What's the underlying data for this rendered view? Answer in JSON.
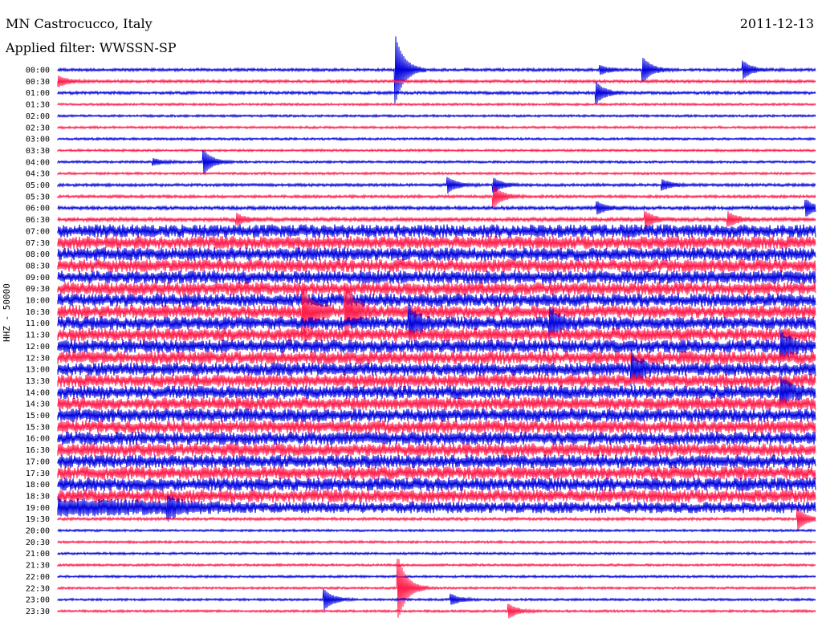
{
  "header": {
    "station": "MN Castrocucco, Italy",
    "date": "2011-12-13",
    "filter": "Applied filter: WWSSN-SP"
  },
  "chart_data": {
    "type": "line",
    "title": "MN Castrocucco, Italy",
    "subtitle": "Applied filter: WWSSN-SP",
    "ylabel": "HHZ - 50000",
    "xlabel": "",
    "colors": [
      "#0000dd",
      "#ff1a4a"
    ],
    "grid": false,
    "categories": [
      "00:00",
      "00:30",
      "01:00",
      "01:30",
      "02:00",
      "02:30",
      "03:00",
      "03:30",
      "04:00",
      "04:30",
      "05:00",
      "05:30",
      "06:00",
      "06:30",
      "07:00",
      "07:30",
      "08:00",
      "08:30",
      "09:00",
      "09:30",
      "10:00",
      "10:30",
      "11:00",
      "11:30",
      "12:00",
      "12:30",
      "13:00",
      "13:30",
      "14:00",
      "14:30",
      "15:00",
      "15:30",
      "16:00",
      "16:30",
      "17:00",
      "17:30",
      "18:00",
      "18:30",
      "19:00",
      "19:30",
      "20:00",
      "20:30",
      "21:00",
      "21:30",
      "22:00",
      "22:30",
      "23:00",
      "23:30"
    ],
    "noise_level": [
      1.5,
      1.5,
      1.5,
      1.2,
      1.2,
      1.2,
      1.2,
      1.2,
      1.2,
      1.2,
      1.5,
      1.5,
      1.8,
      2.0,
      7,
      7,
      7,
      7,
      7,
      7,
      7,
      7,
      7,
      7,
      7,
      7,
      7,
      7,
      7,
      7,
      7,
      7,
      7,
      7,
      7,
      7,
      7,
      7,
      6,
      1.5,
      1.2,
      1.2,
      1.2,
      1.2,
      1.2,
      1.2,
      1.2,
      1.2
    ],
    "events": [
      {
        "time": "00:00",
        "x": 0.446,
        "amp": 40
      },
      {
        "time": "00:00",
        "x": 0.773,
        "amp": 14
      },
      {
        "time": "00:00",
        "x": 0.905,
        "amp": 10
      },
      {
        "time": "00:00",
        "x": 0.716,
        "amp": 5
      },
      {
        "time": "00:30",
        "x": 0.002,
        "amp": 6
      },
      {
        "time": "01:00",
        "x": 0.711,
        "amp": 12
      },
      {
        "time": "04:00",
        "x": 0.193,
        "amp": 14
      },
      {
        "time": "04:00",
        "x": 0.126,
        "amp": 4
      },
      {
        "time": "05:00",
        "x": 0.515,
        "amp": 9
      },
      {
        "time": "05:00",
        "x": 0.576,
        "amp": 8
      },
      {
        "time": "05:00",
        "x": 0.798,
        "amp": 6
      },
      {
        "time": "05:30",
        "x": 0.576,
        "amp": 12
      },
      {
        "time": "06:00",
        "x": 0.712,
        "amp": 7
      },
      {
        "time": "06:00",
        "x": 0.988,
        "amp": 9
      },
      {
        "time": "06:30",
        "x": 0.237,
        "amp": 6
      },
      {
        "time": "06:30",
        "x": 0.776,
        "amp": 9
      },
      {
        "time": "06:30",
        "x": 0.885,
        "amp": 8
      },
      {
        "time": "10:30",
        "x": 0.324,
        "amp": 30
      },
      {
        "time": "10:30",
        "x": 0.38,
        "amp": 28
      },
      {
        "time": "11:00",
        "x": 0.464,
        "amp": 16
      },
      {
        "time": "11:00",
        "x": 0.65,
        "amp": 14
      },
      {
        "time": "12:00",
        "x": 0.955,
        "amp": 14
      },
      {
        "time": "13:00",
        "x": 0.758,
        "amp": 16
      },
      {
        "time": "14:00",
        "x": 0.955,
        "amp": 14
      },
      {
        "time": "19:00",
        "x": 0.146,
        "amp": 10
      },
      {
        "time": "19:30",
        "x": 0.977,
        "amp": 12
      },
      {
        "time": "22:30",
        "x": 0.45,
        "amp": 36
      },
      {
        "time": "23:00",
        "x": 0.352,
        "amp": 12
      },
      {
        "time": "23:00",
        "x": 0.52,
        "amp": 6
      },
      {
        "time": "23:30",
        "x": 0.596,
        "amp": 8
      }
    ]
  }
}
